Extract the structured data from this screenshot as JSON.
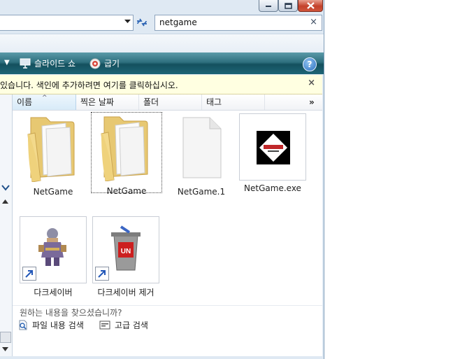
{
  "window": {
    "caption_buttons": {
      "minimize_icon": "minimize-icon",
      "maximize_icon": "maximize-icon",
      "close_icon": "close-icon"
    }
  },
  "search": {
    "value": "netgame",
    "clear_glyph": "×"
  },
  "toolbar": {
    "slideshow_label": "슬라이드 쇼",
    "burn_label": "굽기",
    "help_glyph": "?"
  },
  "infobar": {
    "text": "있습니다. 색인에 추가하려면 여기를 클릭하십시오.",
    "close_glyph": "×"
  },
  "columns": {
    "name": "이름",
    "date": "찍은 날짜",
    "folder": "폴더",
    "tags": "태그",
    "more": "»"
  },
  "items": [
    {
      "label": "NetGame",
      "icon": "folder-icon"
    },
    {
      "label": "NetGame",
      "icon": "folder-icon"
    },
    {
      "label": "NetGame.1",
      "icon": "file-icon"
    },
    {
      "label": "NetGame.exe",
      "icon": "app-icon"
    },
    {
      "label": "다크세이버",
      "icon": "game-character-icon"
    },
    {
      "label": "다크세이버 제거",
      "icon": "uninstall-icon"
    }
  ],
  "help_section": {
    "question": "원하는 내용을 찾으셨습니까?",
    "file_search": "파일 내용 검색",
    "advanced_search": "고급 검색"
  },
  "colors": {
    "toolbar": "#1d6576",
    "infobar": "#ffffe1",
    "selection_header": "#d8ebf8"
  }
}
